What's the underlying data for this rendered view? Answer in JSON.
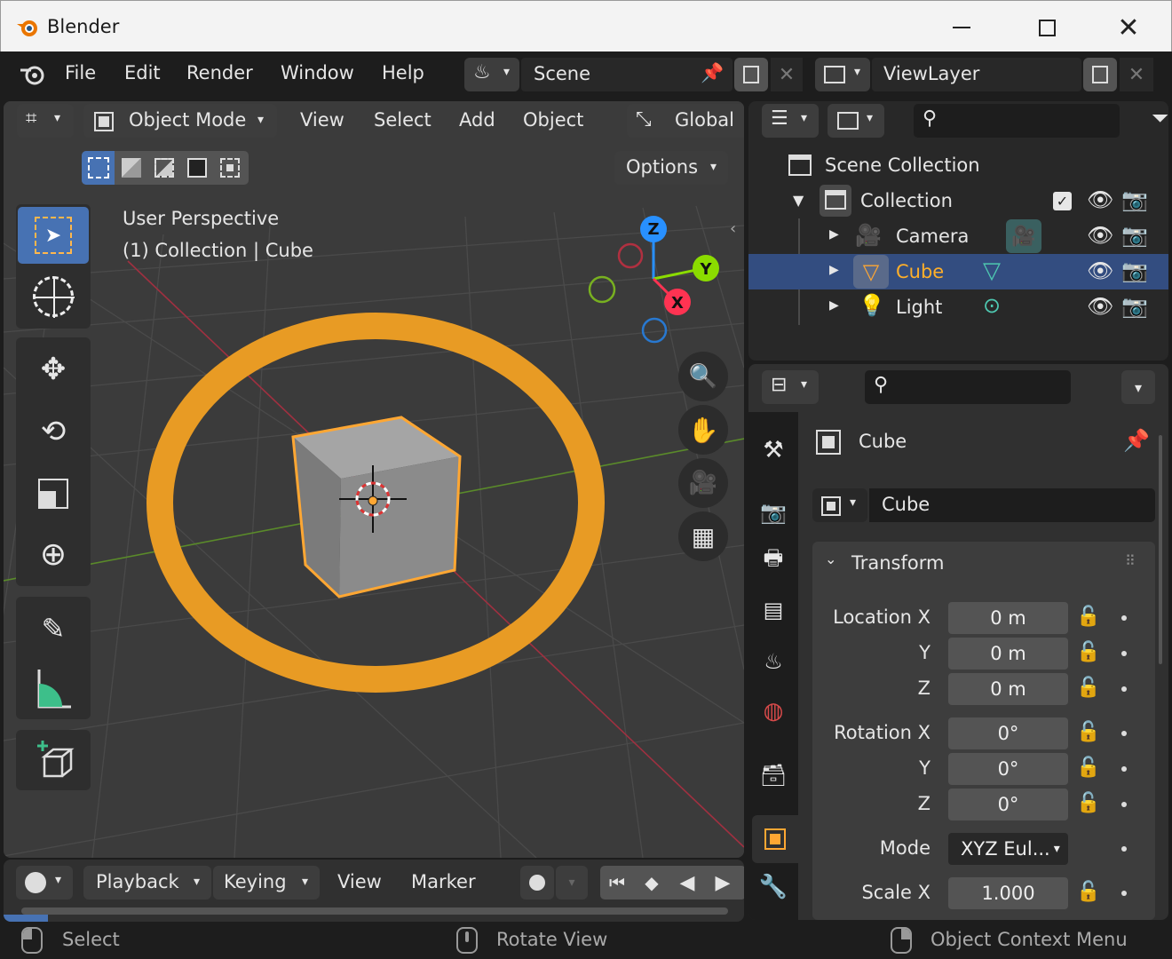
{
  "window": {
    "title": "Blender"
  },
  "menu": {
    "items": [
      "File",
      "Edit",
      "Render",
      "Window",
      "Help"
    ],
    "scene": "Scene",
    "view_layer": "ViewLayer"
  },
  "viewport": {
    "mode": "Object Mode",
    "menus": [
      "View",
      "Select",
      "Add",
      "Object"
    ],
    "orientation": "Global",
    "options": "Options",
    "info_line1": "User Perspective",
    "info_line2": "(1) Collection | Cube",
    "gizmo": {
      "x": "X",
      "y": "Y",
      "z": "Z"
    }
  },
  "timeline": {
    "menus": [
      "Playback",
      "Keying",
      "View",
      "Marker"
    ]
  },
  "outliner": {
    "scene_collection": "Scene Collection",
    "collection": "Collection",
    "items": [
      "Camera",
      "Cube",
      "Light"
    ]
  },
  "properties": {
    "object_name": "Cube",
    "name_field": "Cube",
    "panel": "Transform",
    "rows": [
      {
        "label": "Location X",
        "value": "0 m"
      },
      {
        "label": "Y",
        "value": "0 m"
      },
      {
        "label": "Z",
        "value": "0 m"
      },
      {
        "label": "Rotation X",
        "value": "0°"
      },
      {
        "label": "Y",
        "value": "0°"
      },
      {
        "label": "Z",
        "value": "0°"
      },
      {
        "label": "Mode",
        "value": "XYZ Eul..."
      },
      {
        "label": "Scale X",
        "value": "1.000"
      }
    ]
  },
  "status": {
    "left": "Select",
    "middle": "Rotate View",
    "right": "Object Context Menu"
  },
  "colors": {
    "accent": "#4772b3",
    "selected": "#ffaf29",
    "x_axis": "#ff3352",
    "y_axis": "#8bdc00",
    "z_axis": "#2890ff"
  }
}
